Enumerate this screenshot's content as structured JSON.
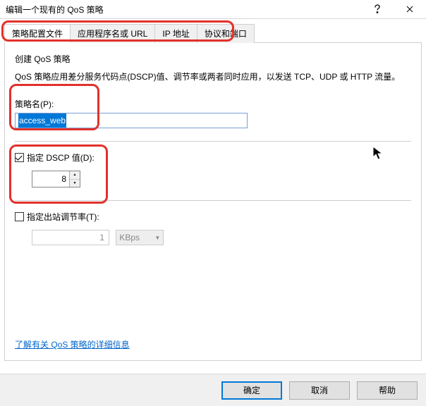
{
  "window": {
    "title": "编辑一个现有的 QoS 策略"
  },
  "tabs": {
    "t1": "策略配置文件",
    "t2": "应用程序名或 URL",
    "t3": "IP 地址",
    "t4": "协议和端口"
  },
  "panel": {
    "heading": "创建 QoS 策略",
    "description": "QoS 策略应用差分服务代码点(DSCP)值、调节率或两者同时应用，以发送 TCP、UDP 或 HTTP 流量。",
    "policy_name_label": "策略名(P):",
    "policy_name_value": "access_web",
    "dscp_checkbox_label": "指定 DSCP 值(D):",
    "dscp_value": "8",
    "throttle_checkbox_label": "指定出站调节率(T):",
    "throttle_value": "1",
    "throttle_unit": "KBps",
    "info_link": "了解有关 QoS 策略的详细信息"
  },
  "buttons": {
    "ok": "确定",
    "cancel": "取消",
    "help": "帮助"
  }
}
